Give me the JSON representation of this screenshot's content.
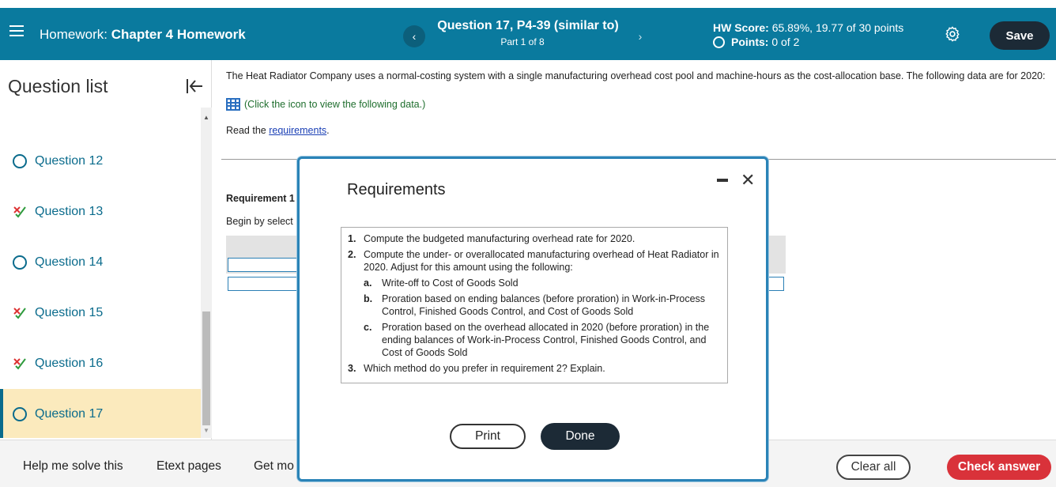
{
  "header": {
    "hw_prefix": "Homework:",
    "hw_name": "Chapter 4 Homework",
    "question_title": "Question 17, P4-39 (similar to)",
    "question_part": "Part 1 of 8",
    "score_label": "HW Score:",
    "score_value": "65.89%, 19.77 of 30 points",
    "points_label": "Points:",
    "points_value": "0 of 2",
    "save_label": "Save",
    "prev_icon": "chevron-left-icon",
    "next_icon": "chevron-right-icon"
  },
  "sidebar": {
    "title": "Question list",
    "items": [
      {
        "label": "Question 12",
        "status": "unanswered"
      },
      {
        "label": "Question 13",
        "status": "partial"
      },
      {
        "label": "Question 14",
        "status": "unanswered"
      },
      {
        "label": "Question 15",
        "status": "partial"
      },
      {
        "label": "Question 16",
        "status": "partial"
      },
      {
        "label": "Question 17",
        "status": "current"
      }
    ]
  },
  "main": {
    "intro": "The Heat Radiator Company uses a normal-costing system with a single manufacturing overhead cost pool and machine-hours as the cost-allocation base. The following data are for 2020:",
    "data_link": "(Click the icon to view the following data.)",
    "read_prefix": "Read the",
    "read_link": "requirements",
    "requirement1": "Requirement 1",
    "begin_text": "Begin by select"
  },
  "modal": {
    "title": "Requirements",
    "items": [
      {
        "num": "1.",
        "text": "Compute the budgeted manufacturing overhead rate for 2020."
      },
      {
        "num": "2.",
        "text": "Compute the under- or overallocated manufacturing overhead of Heat Radiator in 2020. Adjust for this amount using the following:"
      },
      {
        "num": "3.",
        "text": "Which method do you prefer in requirement 2? Explain."
      }
    ],
    "subitems": [
      {
        "num": "a.",
        "text": "Write-off to Cost of Goods Sold"
      },
      {
        "num": "b.",
        "text": "Proration based on ending balances (before proration) in Work-in-Process Control, Finished Goods Control, and Cost of Goods Sold"
      },
      {
        "num": "c.",
        "text": "Proration based on the overhead allocated in 2020 (before proration) in the ending balances of Work-in-Process Control, Finished Goods Control, and Cost of Goods Sold"
      }
    ],
    "print_label": "Print",
    "done_label": "Done"
  },
  "footer": {
    "help_label": "Help me solve this",
    "etext_label": "Etext pages",
    "getmore_label": "Get mo",
    "clear_label": "Clear all",
    "check_label": "Check answer"
  },
  "colors": {
    "header_bg": "#0a7a9e",
    "accent_dark": "#1c2a36",
    "check_red": "#d9323a",
    "active_item_bg": "#fbeabd"
  }
}
